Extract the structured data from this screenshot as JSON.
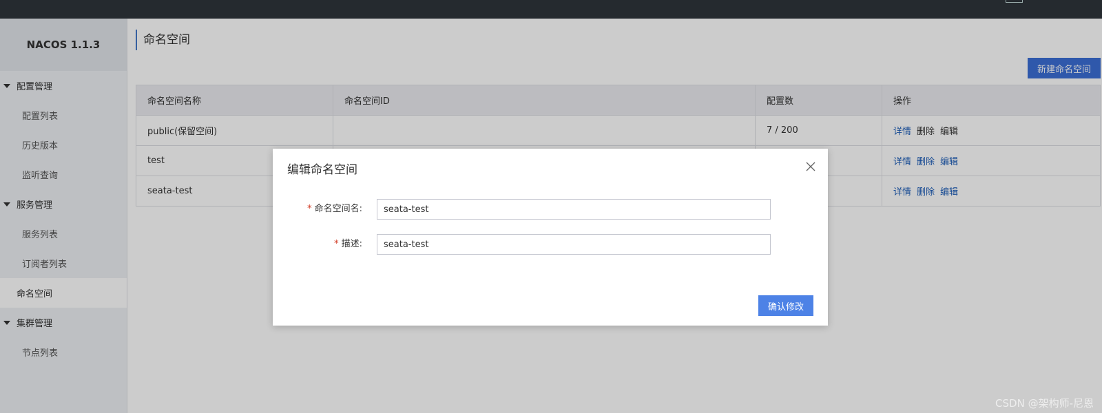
{
  "brand": "NACOS 1.1.3",
  "sidebar": {
    "groups": [
      {
        "label": "配置管理",
        "items": [
          "配置列表",
          "历史版本",
          "监听查询"
        ]
      },
      {
        "label": "服务管理",
        "items": [
          "服务列表",
          "订阅者列表"
        ]
      },
      {
        "label": "命名空间"
      },
      {
        "label": "集群管理",
        "items": [
          "节点列表"
        ]
      }
    ]
  },
  "main": {
    "title": "命名空间",
    "new_button": "新建命名空间",
    "table": {
      "headers": [
        "命名空间名称",
        "命名空间ID",
        "配置数",
        "操作"
      ],
      "rows": [
        {
          "name": "public(保留空间)",
          "id": "",
          "count": "7 / 200"
        },
        {
          "name": "test",
          "id": "",
          "count": ""
        },
        {
          "name": "seata-test",
          "id": "",
          "count": ""
        }
      ],
      "actions": {
        "detail": "详情",
        "delete": "删除",
        "edit": "编辑"
      }
    }
  },
  "dialog": {
    "title": "编辑命名空间",
    "name_label": "命名空间名:",
    "name_value": "seata-test",
    "desc_label": "描述:",
    "desc_value": "seata-test",
    "required_mark": "*",
    "confirm_button": "确认修改"
  },
  "watermark": "CSDN @架构师-尼恩",
  "colors": {
    "primary": "#4d82e6",
    "link": "#1a5bb7",
    "topbar": "#252a2f",
    "required": "#d23c26"
  }
}
